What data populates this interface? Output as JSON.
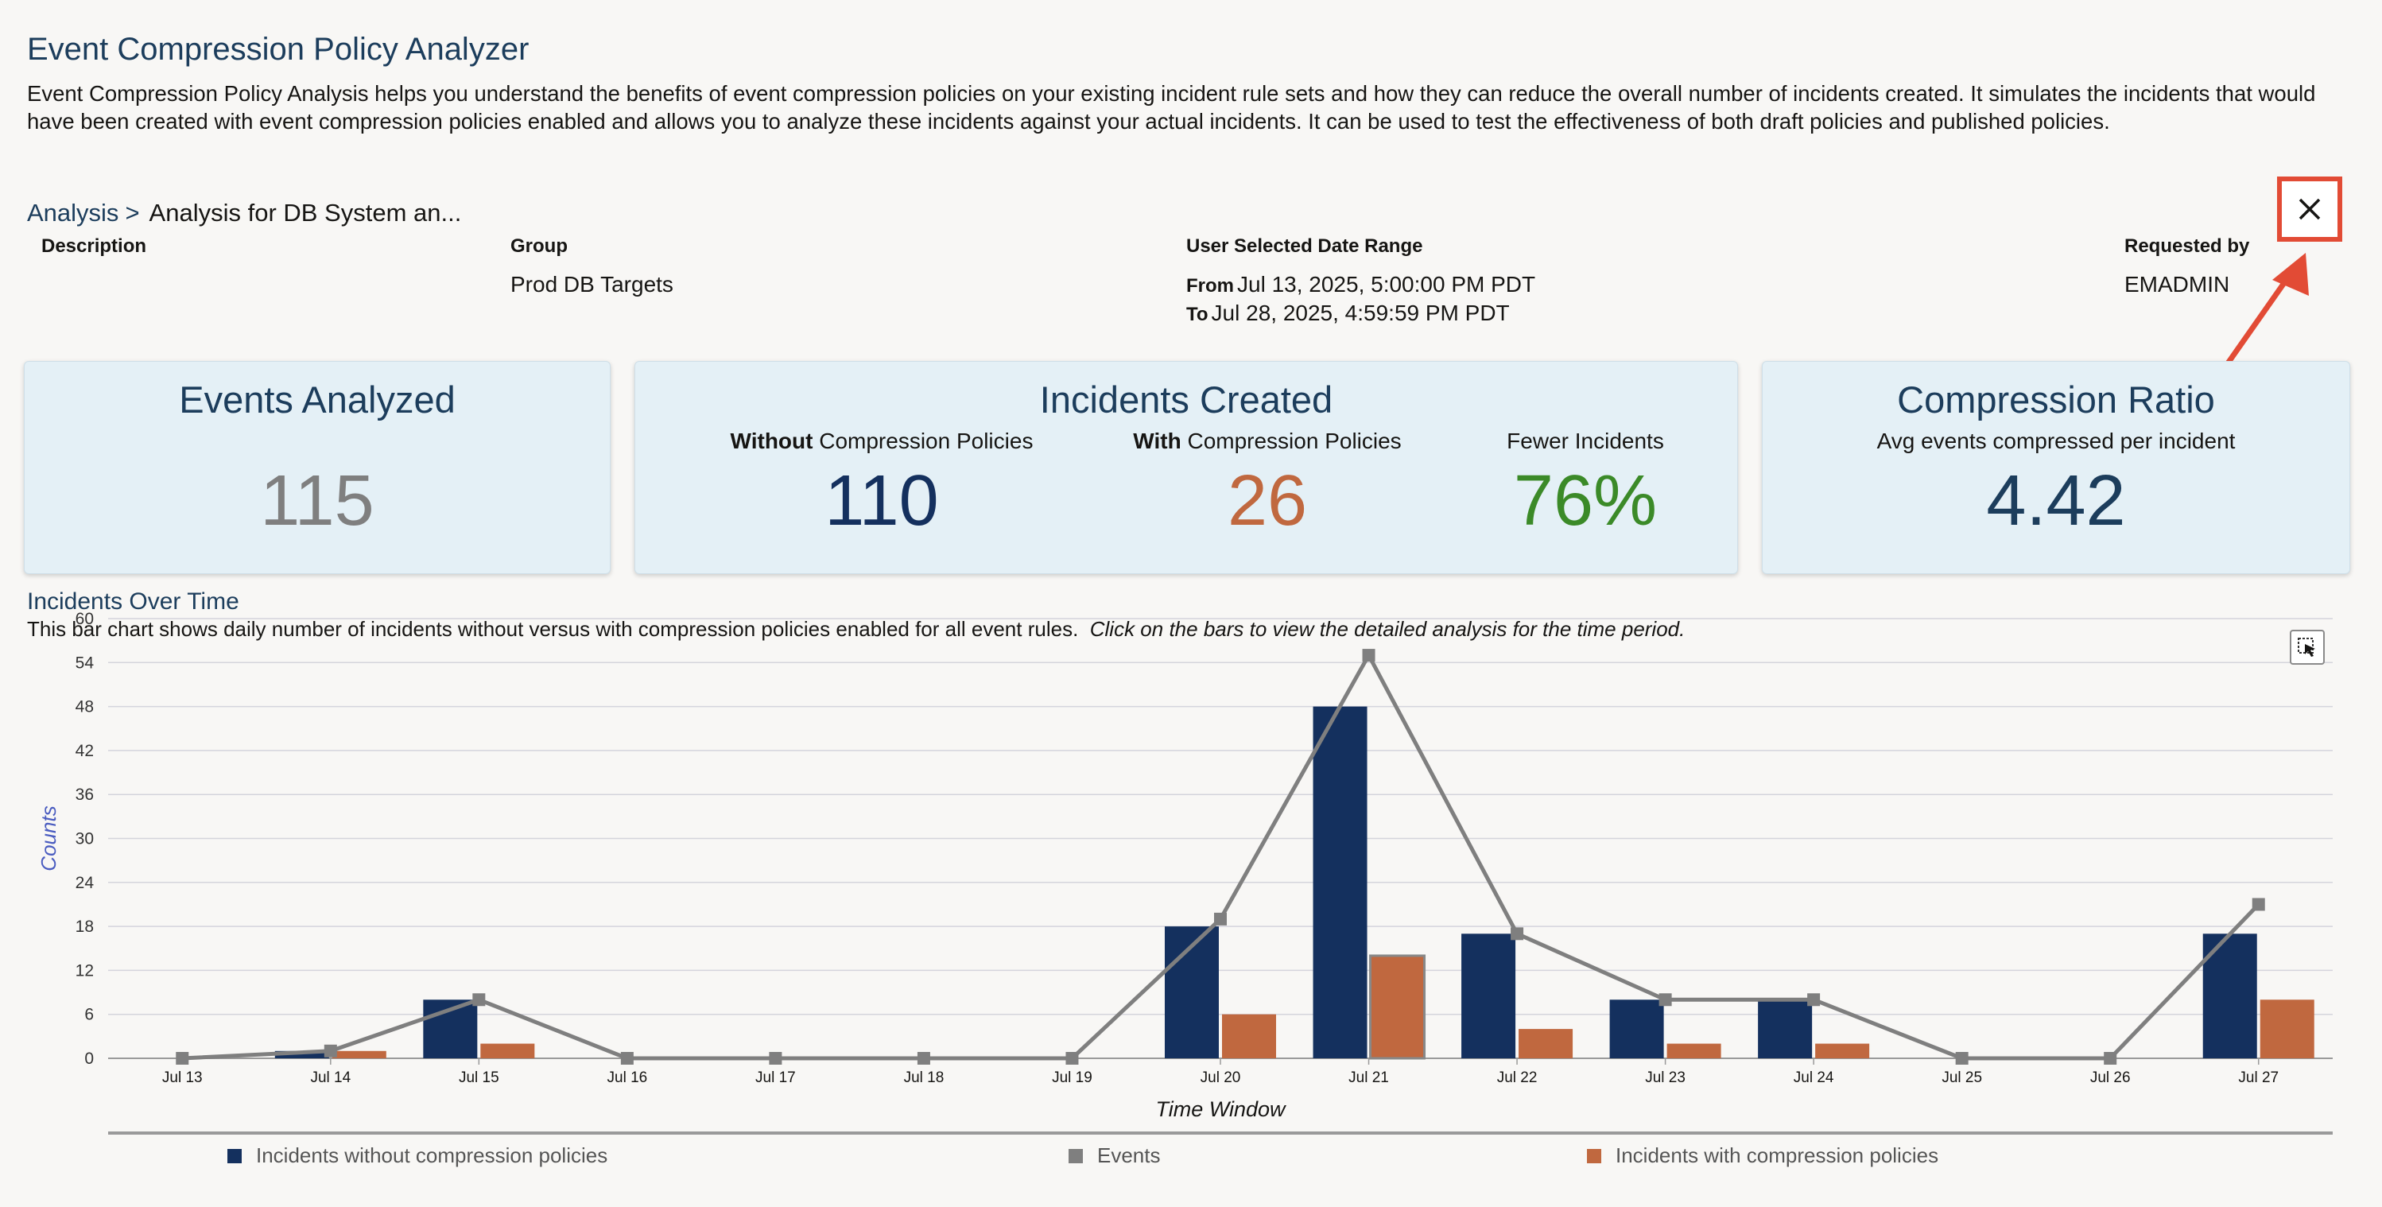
{
  "page": {
    "title": "Event Compression Policy Analyzer",
    "description": "Event Compression Policy Analysis helps you understand the benefits of event compression policies on your existing incident rule sets and how they can reduce the overall number of incidents created. It simulates the incidents that would have been created with event compression policies enabled and allows you to analyze these incidents against your actual incidents. It can be used to test the effectiveness of both draft policies and published policies."
  },
  "breadcrumb": {
    "parent": "Analysis",
    "separator": ">",
    "current": "Analysis for DB System an..."
  },
  "close_icon": "close-x-icon",
  "meta": {
    "description_label": "Description",
    "description_value": "",
    "group_label": "Group",
    "group_value": "Prod DB Targets",
    "date_label": "User Selected Date Range",
    "from_label": "From",
    "from_value": "Jul 13, 2025, 5:00:00 PM PDT",
    "to_label": "To",
    "to_value": "Jul 28, 2025, 4:59:59 PM PDT",
    "requested_label": "Requested by",
    "requested_value": "EMADMIN"
  },
  "cards": {
    "events": {
      "title": "Events Analyzed",
      "value": "115"
    },
    "incidents": {
      "title": "Incidents Created",
      "without_bold": "Without",
      "without_rest": " Compression Policies",
      "without_value": "110",
      "with_bold": "With",
      "with_rest": " Compression Policies",
      "with_value": "26",
      "fewer_label": "Fewer Incidents",
      "fewer_value": "76%"
    },
    "ratio": {
      "title": "Compression Ratio",
      "subtitle": "Avg events compressed per incident",
      "value": "4.42"
    }
  },
  "section": {
    "title": "Incidents Over Time",
    "desc": "This bar chart shows daily number of incidents without versus with compression policies enabled for all event rules.",
    "desc_italic": "Click on the bars to view the detailed analysis for the time period."
  },
  "colors": {
    "navy": "#14305e",
    "orange": "#c0683f",
    "grey": "#7f7f7f",
    "green": "#3b8a28",
    "title": "#1c3d5c",
    "accent_red": "#e24b35"
  },
  "chart_data": {
    "type": "bar",
    "categories": [
      "Jul 13",
      "Jul 14",
      "Jul 15",
      "Jul 16",
      "Jul 17",
      "Jul 18",
      "Jul 19",
      "Jul 20",
      "Jul 21",
      "Jul 22",
      "Jul 23",
      "Jul 24",
      "Jul 25",
      "Jul 26",
      "Jul 27"
    ],
    "series": [
      {
        "name": "Incidents without compression policies",
        "kind": "bar",
        "color": "#14305e",
        "values": [
          0,
          1,
          8,
          0,
          0,
          0,
          0,
          18,
          48,
          17,
          8,
          8,
          0,
          0,
          17
        ]
      },
      {
        "name": "Events",
        "kind": "line",
        "color": "#7f7f7f",
        "values": [
          0,
          1,
          8,
          0,
          0,
          0,
          0,
          19,
          55,
          17,
          8,
          8,
          0,
          0,
          21
        ]
      },
      {
        "name": "Incidents with compression policies",
        "kind": "bar",
        "color": "#c0683f",
        "values": [
          0,
          1,
          2,
          0,
          0,
          0,
          0,
          6,
          14,
          4,
          2,
          2,
          0,
          0,
          8
        ]
      }
    ],
    "xlabel": "Time Window",
    "ylabel": "Counts",
    "ylim": [
      0,
      60
    ],
    "yticks": [
      0,
      6,
      12,
      18,
      24,
      30,
      36,
      42,
      48,
      54,
      60
    ],
    "grid": true,
    "legend": "bottom"
  }
}
